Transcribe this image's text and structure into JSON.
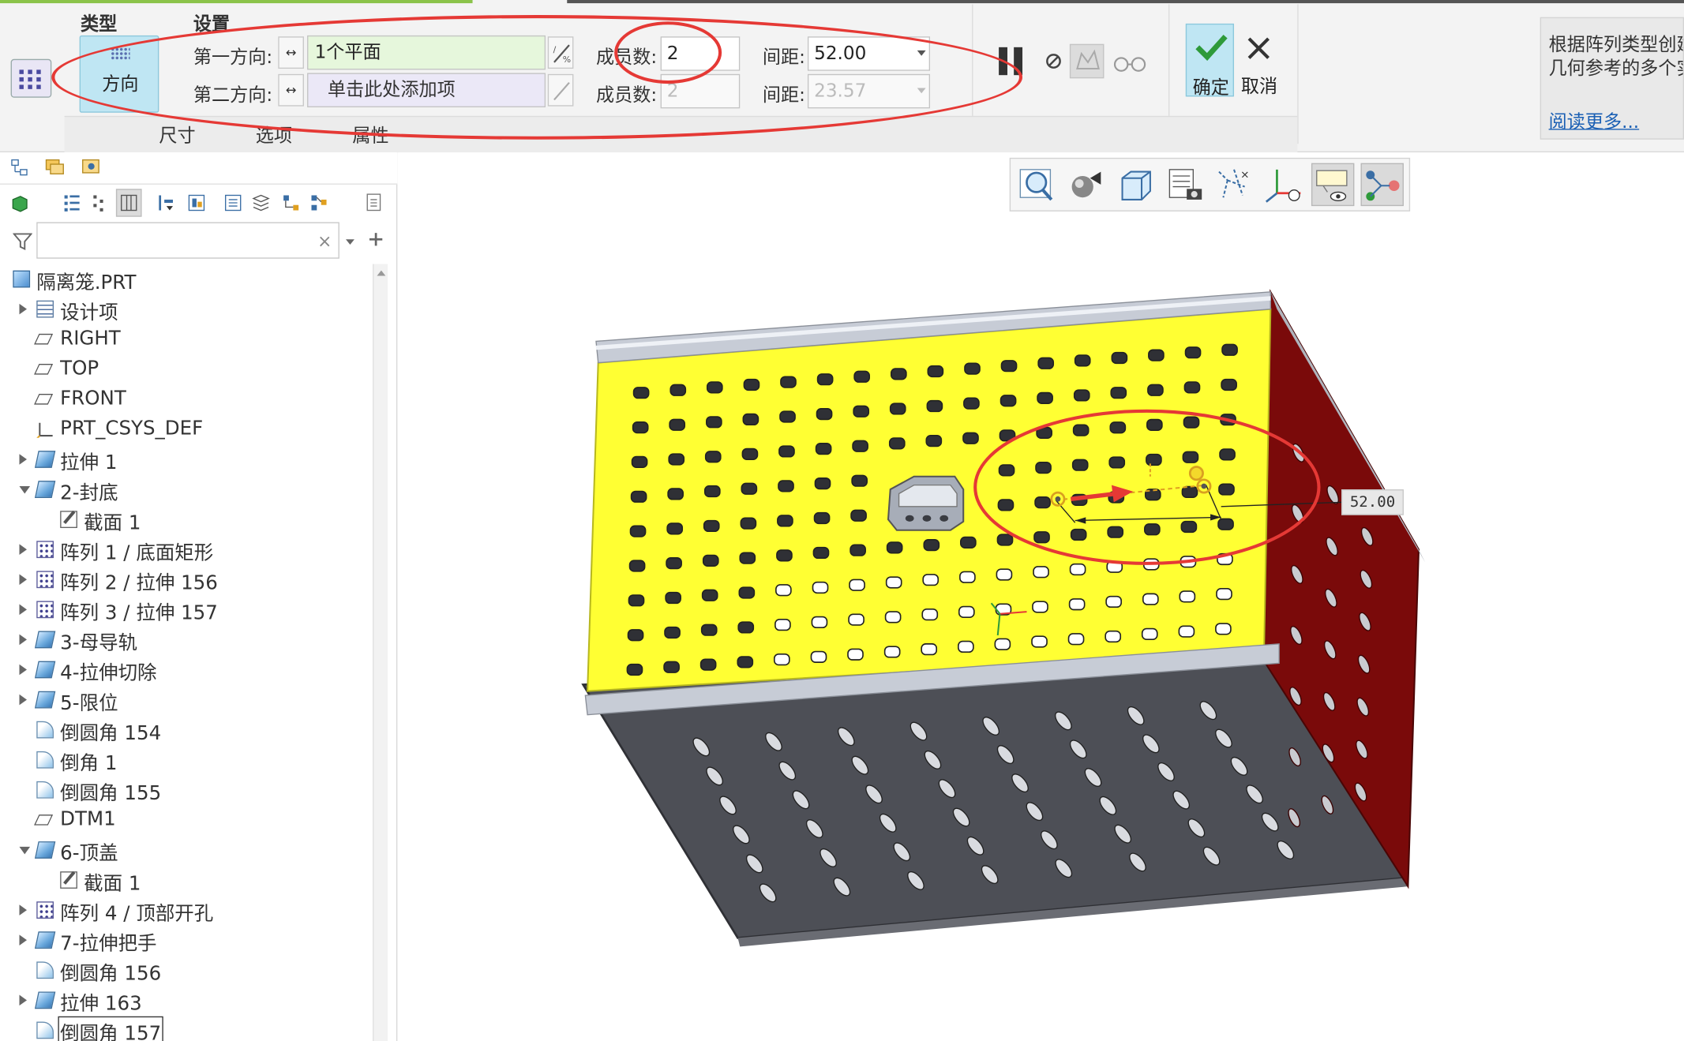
{
  "ribbon": {
    "group_type_label": "类型",
    "group_settings_label": "设置",
    "direction_button": "方向",
    "dir1_label": "第一方向:",
    "dir1_collector": "1个平面",
    "dir2_label": "第二方向:",
    "dir2_collector": "单击此处添加项",
    "members1_label": "成员数:",
    "members1_value": "2",
    "members2_label": "成员数:",
    "members2_value": "2",
    "spacing1_label": "间距:",
    "spacing1_value": "52.00",
    "spacing2_label": "间距:",
    "spacing2_value": "23.57",
    "ok_label": "确定",
    "cancel_label": "取消",
    "tabs": [
      "尺寸",
      "选项",
      "属性"
    ],
    "help_line1": "根据阵列类型创建",
    "help_line2": "几何参考的多个实",
    "help_link": "阅读更多..."
  },
  "tree": {
    "root": "隔离笼.PRT",
    "items": [
      {
        "label": "设计项",
        "icon": "design-items-icon"
      },
      {
        "label": "RIGHT",
        "icon": "datum-plane-icon"
      },
      {
        "label": "TOP",
        "icon": "datum-plane-icon"
      },
      {
        "label": "FRONT",
        "icon": "datum-plane-icon"
      },
      {
        "label": "PRT_CSYS_DEF",
        "icon": "csys-icon"
      },
      {
        "label": "拉伸 1",
        "icon": "extrude-icon"
      },
      {
        "label": "2-封底",
        "icon": "extrude-icon"
      },
      {
        "label": "截面 1",
        "icon": "sketch-icon"
      },
      {
        "label": "阵列 1 / 底面矩形",
        "icon": "pattern-icon"
      },
      {
        "label": "阵列 2 / 拉伸 156",
        "icon": "pattern-icon"
      },
      {
        "label": "阵列 3 / 拉伸 157",
        "icon": "pattern-icon"
      },
      {
        "label": "3-母导轨",
        "icon": "extrude-icon"
      },
      {
        "label": "4-拉伸切除",
        "icon": "extrude-icon"
      },
      {
        "label": "5-限位",
        "icon": "extrude-icon"
      },
      {
        "label": "倒圆角 154",
        "icon": "round-icon"
      },
      {
        "label": "倒角 1",
        "icon": "chamfer-icon"
      },
      {
        "label": "倒圆角 155",
        "icon": "round-icon"
      },
      {
        "label": "DTM1",
        "icon": "datum-plane-icon"
      },
      {
        "label": "6-顶盖",
        "icon": "extrude-icon"
      },
      {
        "label": "截面 1",
        "icon": "sketch-icon"
      },
      {
        "label": "阵列 4 / 顶部开孔",
        "icon": "pattern-icon"
      },
      {
        "label": "7-拉伸把手",
        "icon": "extrude-icon"
      },
      {
        "label": "倒圆角 156",
        "icon": "round-icon"
      },
      {
        "label": "拉伸 163",
        "icon": "extrude-icon"
      },
      {
        "label": "倒圆角 157",
        "icon": "round-icon"
      }
    ]
  },
  "viewport": {
    "dimension_value": "52.00",
    "toolbar_icons": [
      "refit-icon",
      "display-style-icon",
      "saved-orientations-icon",
      "view-manager-icon",
      "datum-display-icon",
      "csys-display-icon",
      "annotation-display-icon",
      "spin-center-icon"
    ]
  },
  "colors": {
    "accent_ok": "#bfe6f3",
    "highlight_red": "#e53935",
    "face_yellow": "#ffff33",
    "face_dark": "#4d4f56",
    "face_maroon": "#7a0a0a"
  }
}
